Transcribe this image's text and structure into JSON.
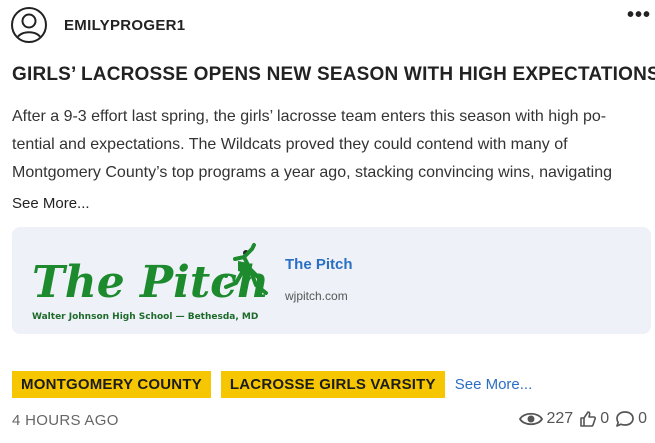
{
  "post": {
    "username": "EMILYPROGER1",
    "headline": "GIRLS’ LACROSSE OPENS NEW SEASON WITH HIGH EXPECTATIONS",
    "body_line1": "After a 9-3 effort last spring, the girls’ lacrosse team enters this season with high po-",
    "body_line2": "tential and expectations. The Wildcats proved they could contend with many of",
    "body_line3": "Montgomery County’s top programs a year ago, stacking convincing wins, navigating",
    "see_more": "See More...",
    "timestamp": "4 HOURS AGO"
  },
  "link_card": {
    "title": "The Pitch",
    "domain": "wjpitch.com",
    "logo_text": "The Pitch",
    "logo_subtext": "Walter Johnson High School — Bethesda, MD"
  },
  "tags": [
    {
      "label": "MONTGOMERY COUNTY"
    },
    {
      "label": "LACROSSE GIRLS VARSITY"
    }
  ],
  "tags_more": "See More...",
  "stats": {
    "views": "227",
    "likes": "0",
    "comments": "0"
  },
  "colors": {
    "tag_bg": "#f6c700",
    "link": "#2a6fc4",
    "card_bg": "#eef2f8",
    "logo_green": "#1d8a2e"
  }
}
